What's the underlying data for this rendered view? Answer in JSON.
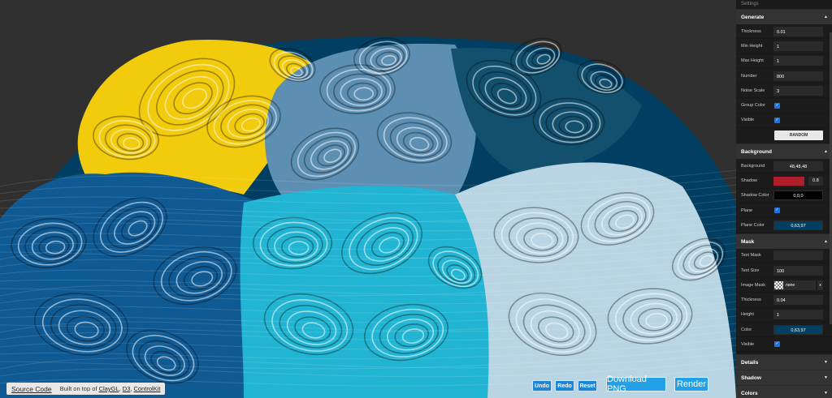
{
  "credits": {
    "source_code": "Source Code",
    "built_on": "Built on top of",
    "lib1": "ClayGL",
    "lib2": "D3",
    "lib3": "ControlKit"
  },
  "toolbar": {
    "undo": "Undo",
    "redo": "Redo",
    "reset": "Reset",
    "download_png": "Download PNG",
    "render": "Render"
  },
  "panel": {
    "title": "Settings",
    "generate": {
      "header": "Generate",
      "thickness_label": "Thickness",
      "thickness": "0.01",
      "min_height_label": "Min Height",
      "min_height": "1",
      "max_height_label": "Max Height",
      "max_height": "1",
      "number_label": "Number",
      "number": "800",
      "noise_scale_label": "Noise Scale",
      "noise_scale": "3",
      "group_color_label": "Group Color",
      "visible_label": "Visible",
      "random_label": "RANDOM"
    },
    "background": {
      "header": "Background",
      "background_label": "Background",
      "background": "48,48,48",
      "shadow_label": "Shadow",
      "shadow_value": "0.8",
      "shadow_color": "#b01e2b",
      "shadow_color_label": "Shadow Color",
      "shadow_color_value": "0,0,0",
      "plane_label": "Plane",
      "plane_color_label": "Plane Color",
      "plane_color": "0,63,97"
    },
    "mask": {
      "header": "Mask",
      "text_mask_label": "Text Mask",
      "text_mask": "",
      "text_size_label": "Text Size",
      "text_size": "100",
      "image_mask_label": "Image Mask",
      "image_mask": "none",
      "image_clear": "x",
      "thickness_label": "Thickness",
      "thickness": "0.04",
      "height_label": "Height",
      "height": "1",
      "color_label": "Color",
      "color": "0,63,97",
      "visible_label": "Visible"
    },
    "details": {
      "header": "Details"
    },
    "shadow": {
      "header": "Shadow"
    },
    "colors": {
      "header": "Colors"
    }
  },
  "colors": {
    "yellow": "#f2cb0c",
    "dark_blue": "#0f5a93",
    "steel_blue": "#5d8fb3",
    "teal_dark": "#13506e",
    "cyan": "#22b5d3",
    "pale_blue": "#b9d5e3",
    "plane": "#003f61"
  }
}
